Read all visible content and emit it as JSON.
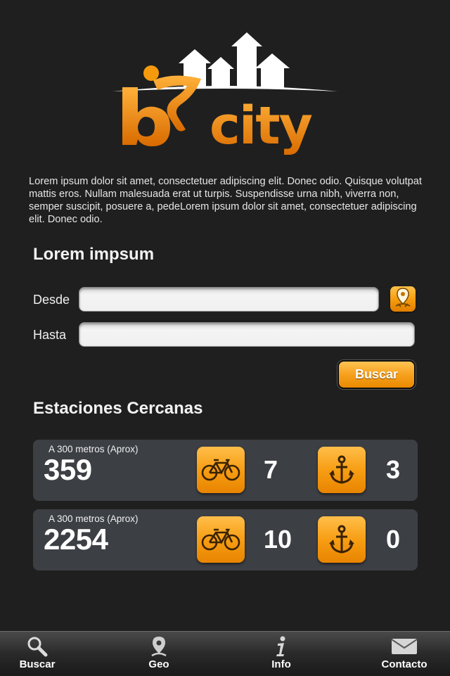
{
  "logo": {
    "text": "bcity"
  },
  "intro": {
    "text": "Lorem ipsum dolor sit amet, consectetuer adipiscing elit. Donec odio. Quisque volutpat mattis eros. Nullam malesuada erat ut turpis. Suspendisse urna nibh, viverra non, semper suscipit, posuere a, pedeLorem ipsum dolor sit amet, consectetuer adipiscing elit. Donec odio."
  },
  "form": {
    "title": "Lorem impsum",
    "desde_label": "Desde",
    "desde_value": "",
    "hasta_label": "Hasta",
    "hasta_value": "",
    "submit_label": "Buscar"
  },
  "stations": {
    "title": "Estaciones Cercanas",
    "items": [
      {
        "distance": "A 300 metros (Aprox)",
        "id": "359",
        "bikes": "7",
        "docks": "3"
      },
      {
        "distance": "A 300 metros (Aprox)",
        "id": "2254",
        "bikes": "10",
        "docks": "0"
      }
    ]
  },
  "tabbar": {
    "tabs": [
      {
        "label": "Buscar",
        "icon": "search-icon"
      },
      {
        "label": "Geo",
        "icon": "map-pin-icon"
      },
      {
        "label": "Info",
        "icon": "info-icon"
      },
      {
        "label": "Contacto",
        "icon": "envelope-icon"
      }
    ]
  },
  "colors": {
    "background": "#1f1f1f",
    "accent": "#f59a0c",
    "card": "#3c3f44"
  }
}
